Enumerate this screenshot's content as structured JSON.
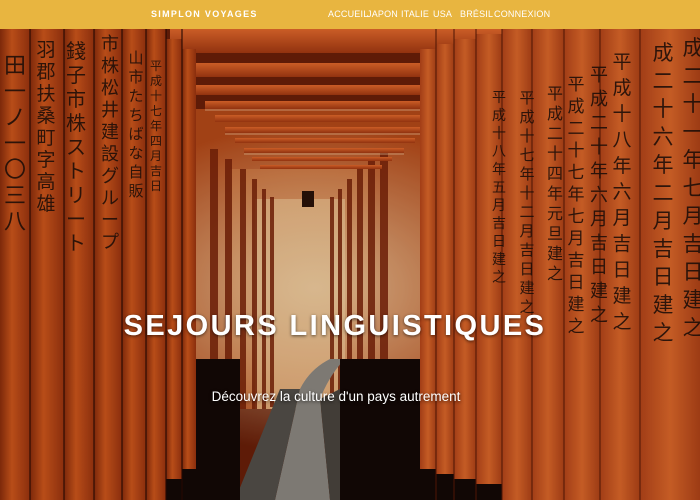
{
  "header": {
    "brand": "SIMPLON VOYAGES",
    "nav": [
      "ACCUEIL",
      "JAPON",
      "ITALIE",
      "USA",
      "BRÉSIL",
      "CONNEXION"
    ]
  },
  "hero": {
    "title": "SEJOURS LINGUISTIQUES",
    "subtitle": "Découvrez la culture d'un pays autrement",
    "image": "torii-gates-tunnel-photo"
  },
  "colors": {
    "header_bg": "#e8b540",
    "torii_orange": "#c8501a",
    "text": "#ffffff"
  }
}
